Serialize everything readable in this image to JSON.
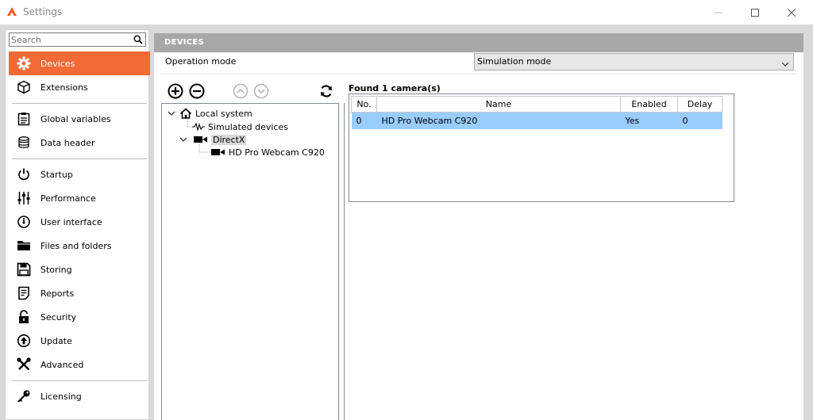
{
  "window": {
    "title": "Settings",
    "controls": {
      "minimize": "—",
      "maximize": "☐",
      "close": "✕"
    }
  },
  "sidebar": {
    "search_placeholder": "Search",
    "items": [
      {
        "label": "Devices",
        "icon": "gear-icon",
        "active": true
      },
      {
        "label": "Extensions",
        "icon": "cube-icon"
      },
      {
        "label": "Global variables",
        "icon": "clipboard-icon"
      },
      {
        "label": "Data header",
        "icon": "database-icon"
      },
      {
        "label": "Startup",
        "icon": "power-icon"
      },
      {
        "label": "Performance",
        "icon": "sliders-icon"
      },
      {
        "label": "User interface",
        "icon": "gauge-icon"
      },
      {
        "label": "Files and folders",
        "icon": "folder-icon"
      },
      {
        "label": "Storing",
        "icon": "floppy-disk-icon"
      },
      {
        "label": "Reports",
        "icon": "report-icon"
      },
      {
        "label": "Security",
        "icon": "lock-icon"
      },
      {
        "label": "Update",
        "icon": "update-icon"
      },
      {
        "label": "Advanced",
        "icon": "tools-icon"
      },
      {
        "label": "Licensing",
        "icon": "key-icon"
      }
    ]
  },
  "main": {
    "section_title": "DEVICES",
    "operation_mode_label": "Operation mode",
    "operation_mode_value": "Simulation mode",
    "toolbar": [
      "add-icon",
      "remove-icon",
      "move-up-icon",
      "move-down-icon",
      "refresh-icon"
    ],
    "tree": {
      "root": "Local system",
      "simulated": "Simulated devices",
      "directx": "DirectX",
      "camera": "HD Pro Webcam C920"
    },
    "found_label": "Found 1 camera(s)",
    "grid": {
      "columns": [
        "No.",
        "Name",
        "Enabled",
        "Delay"
      ],
      "rows": [
        {
          "no": "0",
          "name": "HD Pro Webcam C920",
          "enabled": "Yes",
          "delay": "0"
        }
      ]
    }
  },
  "colors": {
    "accent": "#f26a35",
    "selection": "#99ccff",
    "header": "#a7a7a7"
  }
}
